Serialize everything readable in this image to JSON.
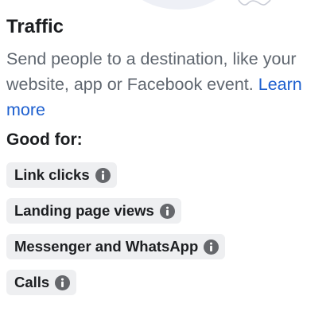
{
  "objective": {
    "title": "Traffic",
    "description": "Send people to a destination, like your website, app or Facebook event.",
    "learn_more": "Learn more"
  },
  "good_for": {
    "heading": "Good for:",
    "items": [
      {
        "label": "Link clicks",
        "icon": "info-icon"
      },
      {
        "label": "Landing page views",
        "icon": "info-icon"
      },
      {
        "label": "Messenger and WhatsApp",
        "icon": "info-icon"
      },
      {
        "label": "Calls",
        "icon": "info-icon"
      }
    ]
  },
  "colors": {
    "text_primary": "#1c1e21",
    "text_secondary": "#606770",
    "link": "#1d5fcf",
    "chip_bg": "#eeeff1",
    "icon": "#65676b"
  }
}
